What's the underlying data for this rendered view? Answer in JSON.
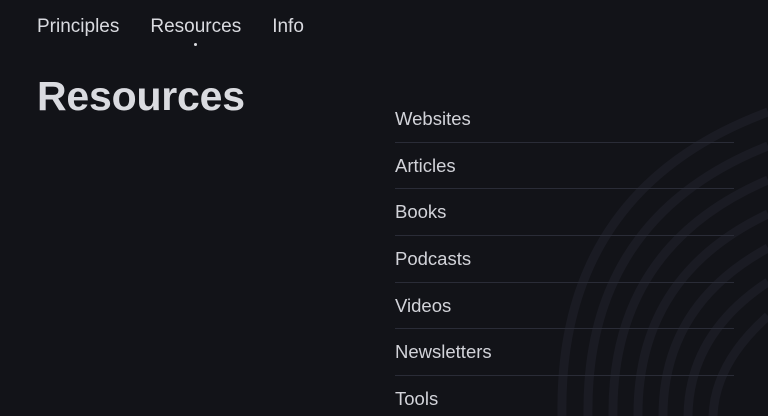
{
  "nav": {
    "items": [
      {
        "label": "Principles"
      },
      {
        "label": "Resources",
        "active": true
      },
      {
        "label": "Info"
      }
    ]
  },
  "page": {
    "title": "Resources"
  },
  "resources": {
    "items": [
      {
        "label": "Websites"
      },
      {
        "label": "Articles"
      },
      {
        "label": "Books"
      },
      {
        "label": "Podcasts"
      },
      {
        "label": "Videos"
      },
      {
        "label": "Newsletters"
      },
      {
        "label": "Tools"
      }
    ]
  },
  "colors": {
    "background": "#121318",
    "text": "#d9dadf",
    "divider": "#2a2c37"
  }
}
